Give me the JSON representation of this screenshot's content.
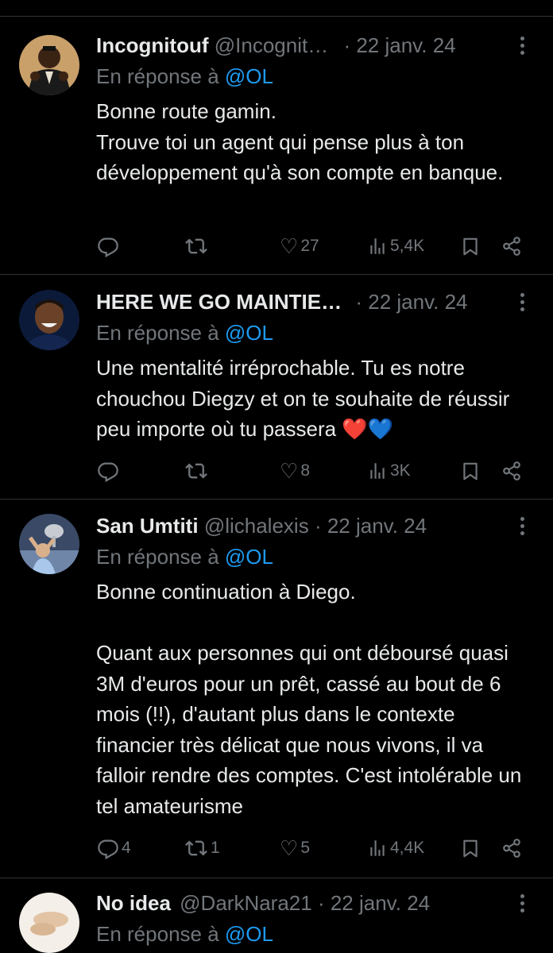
{
  "tweets": [
    {
      "name": "Incognitouf",
      "handle": "@Incognit…",
      "date": "· 22 janv. 24",
      "reply_prefix": "En réponse à",
      "reply_to": "@OL",
      "text": "Bonne route gamin.\nTrouve toi un agent qui pense plus à ton développement qu'à son compte en banque.",
      "replies": "",
      "retweets": "",
      "likes": "27",
      "views": "5,4K"
    },
    {
      "name": "HERE WE GO MAINTIE…",
      "handle": "",
      "date": "· 22 janv. 24",
      "reply_prefix": "En réponse à",
      "reply_to": "@OL",
      "text": "Une mentalité irréprochable. Tu es notre chouchou Diegzy et on te souhaite de réussir peu importe où tu passera",
      "emoji": "❤️💙",
      "replies": "",
      "retweets": "",
      "likes": "8",
      "views": "3K"
    },
    {
      "name": "San Umtiti",
      "handle": "@lichalexis",
      "date": "· 22 janv. 24",
      "reply_prefix": "En réponse à",
      "reply_to": "@OL",
      "text": "Bonne continuation à Diego.\n\nQuant aux personnes qui ont déboursé quasi 3M d'euros pour un prêt, cassé au bout de 6 mois (!!), d'autant plus dans le contexte financier très délicat que nous vivons, il va falloir rendre des comptes. C'est intolérable un tel amateurisme",
      "replies": "4",
      "retweets": "1",
      "likes": "5",
      "views": "4,4K"
    },
    {
      "name": "No idea",
      "handle": "@DarkNara21",
      "date": "· 22 janv. 24",
      "reply_prefix": "En réponse à",
      "reply_to": "@OL"
    }
  ],
  "icons": {
    "reply": "reply-icon",
    "retweet": "retweet-icon",
    "like": "heart-icon",
    "views": "views-icon",
    "bookmark": "bookmark-icon",
    "share": "share-icon",
    "more": "more-dots-icon"
  },
  "colors": {
    "background": "#000000",
    "text": "#e7e9ea",
    "muted": "#71767b",
    "link": "#1d9bf0",
    "divider": "#2f3336"
  }
}
